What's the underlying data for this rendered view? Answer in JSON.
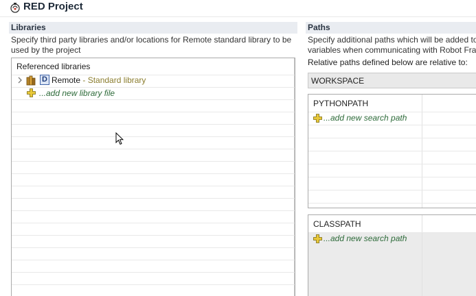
{
  "header": {
    "title": "RED Project",
    "icon": "red-project-icon"
  },
  "libraries": {
    "section_title": "Libraries",
    "description_line1": "Specify third party libraries and/or locations for Remote standard library to be",
    "description_line2": "used by the project",
    "list_header": "Referenced libraries",
    "items": [
      {
        "badge": "D",
        "name": "Remote",
        "type": " - Standard library"
      }
    ],
    "add_label": "...add new library file"
  },
  "paths": {
    "section_title": "Paths",
    "description_line1": "Specify additional paths which will be added to",
    "description_line2": "variables when communicating with Robot Fra",
    "relative_label": "Relative paths defined below are relative to:",
    "relative_to_value": "WORKSPACE",
    "pythonpath": {
      "header": "PYTHONPATH",
      "add_label": "...add new search path"
    },
    "classpath": {
      "header": "CLASSPATH",
      "add_label": "...add new search path"
    }
  },
  "colors": {
    "section_bg": "#e9ecf1",
    "add_link": "#2e6b3a",
    "library_type": "#8b7d2e",
    "badge_border": "#3e62a8"
  }
}
